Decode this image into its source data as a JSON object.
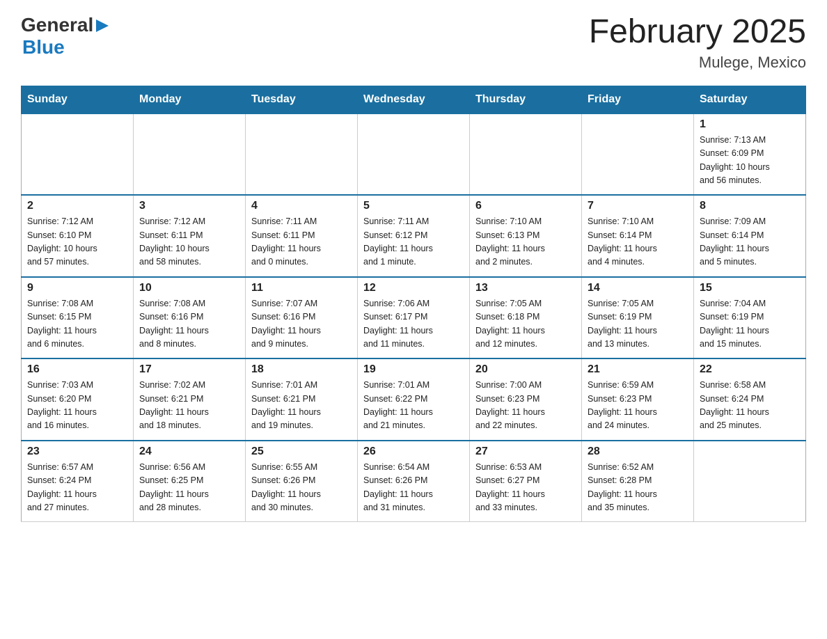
{
  "logo": {
    "general": "General",
    "blue": "Blue"
  },
  "title": "February 2025",
  "subtitle": "Mulege, Mexico",
  "weekdays": [
    "Sunday",
    "Monday",
    "Tuesday",
    "Wednesday",
    "Thursday",
    "Friday",
    "Saturday"
  ],
  "weeks": [
    [
      {
        "day": "",
        "info": ""
      },
      {
        "day": "",
        "info": ""
      },
      {
        "day": "",
        "info": ""
      },
      {
        "day": "",
        "info": ""
      },
      {
        "day": "",
        "info": ""
      },
      {
        "day": "",
        "info": ""
      },
      {
        "day": "1",
        "info": "Sunrise: 7:13 AM\nSunset: 6:09 PM\nDaylight: 10 hours\nand 56 minutes."
      }
    ],
    [
      {
        "day": "2",
        "info": "Sunrise: 7:12 AM\nSunset: 6:10 PM\nDaylight: 10 hours\nand 57 minutes."
      },
      {
        "day": "3",
        "info": "Sunrise: 7:12 AM\nSunset: 6:11 PM\nDaylight: 10 hours\nand 58 minutes."
      },
      {
        "day": "4",
        "info": "Sunrise: 7:11 AM\nSunset: 6:11 PM\nDaylight: 11 hours\nand 0 minutes."
      },
      {
        "day": "5",
        "info": "Sunrise: 7:11 AM\nSunset: 6:12 PM\nDaylight: 11 hours\nand 1 minute."
      },
      {
        "day": "6",
        "info": "Sunrise: 7:10 AM\nSunset: 6:13 PM\nDaylight: 11 hours\nand 2 minutes."
      },
      {
        "day": "7",
        "info": "Sunrise: 7:10 AM\nSunset: 6:14 PM\nDaylight: 11 hours\nand 4 minutes."
      },
      {
        "day": "8",
        "info": "Sunrise: 7:09 AM\nSunset: 6:14 PM\nDaylight: 11 hours\nand 5 minutes."
      }
    ],
    [
      {
        "day": "9",
        "info": "Sunrise: 7:08 AM\nSunset: 6:15 PM\nDaylight: 11 hours\nand 6 minutes."
      },
      {
        "day": "10",
        "info": "Sunrise: 7:08 AM\nSunset: 6:16 PM\nDaylight: 11 hours\nand 8 minutes."
      },
      {
        "day": "11",
        "info": "Sunrise: 7:07 AM\nSunset: 6:16 PM\nDaylight: 11 hours\nand 9 minutes."
      },
      {
        "day": "12",
        "info": "Sunrise: 7:06 AM\nSunset: 6:17 PM\nDaylight: 11 hours\nand 11 minutes."
      },
      {
        "day": "13",
        "info": "Sunrise: 7:05 AM\nSunset: 6:18 PM\nDaylight: 11 hours\nand 12 minutes."
      },
      {
        "day": "14",
        "info": "Sunrise: 7:05 AM\nSunset: 6:19 PM\nDaylight: 11 hours\nand 13 minutes."
      },
      {
        "day": "15",
        "info": "Sunrise: 7:04 AM\nSunset: 6:19 PM\nDaylight: 11 hours\nand 15 minutes."
      }
    ],
    [
      {
        "day": "16",
        "info": "Sunrise: 7:03 AM\nSunset: 6:20 PM\nDaylight: 11 hours\nand 16 minutes."
      },
      {
        "day": "17",
        "info": "Sunrise: 7:02 AM\nSunset: 6:21 PM\nDaylight: 11 hours\nand 18 minutes."
      },
      {
        "day": "18",
        "info": "Sunrise: 7:01 AM\nSunset: 6:21 PM\nDaylight: 11 hours\nand 19 minutes."
      },
      {
        "day": "19",
        "info": "Sunrise: 7:01 AM\nSunset: 6:22 PM\nDaylight: 11 hours\nand 21 minutes."
      },
      {
        "day": "20",
        "info": "Sunrise: 7:00 AM\nSunset: 6:23 PM\nDaylight: 11 hours\nand 22 minutes."
      },
      {
        "day": "21",
        "info": "Sunrise: 6:59 AM\nSunset: 6:23 PM\nDaylight: 11 hours\nand 24 minutes."
      },
      {
        "day": "22",
        "info": "Sunrise: 6:58 AM\nSunset: 6:24 PM\nDaylight: 11 hours\nand 25 minutes."
      }
    ],
    [
      {
        "day": "23",
        "info": "Sunrise: 6:57 AM\nSunset: 6:24 PM\nDaylight: 11 hours\nand 27 minutes."
      },
      {
        "day": "24",
        "info": "Sunrise: 6:56 AM\nSunset: 6:25 PM\nDaylight: 11 hours\nand 28 minutes."
      },
      {
        "day": "25",
        "info": "Sunrise: 6:55 AM\nSunset: 6:26 PM\nDaylight: 11 hours\nand 30 minutes."
      },
      {
        "day": "26",
        "info": "Sunrise: 6:54 AM\nSunset: 6:26 PM\nDaylight: 11 hours\nand 31 minutes."
      },
      {
        "day": "27",
        "info": "Sunrise: 6:53 AM\nSunset: 6:27 PM\nDaylight: 11 hours\nand 33 minutes."
      },
      {
        "day": "28",
        "info": "Sunrise: 6:52 AM\nSunset: 6:28 PM\nDaylight: 11 hours\nand 35 minutes."
      },
      {
        "day": "",
        "info": ""
      }
    ]
  ]
}
